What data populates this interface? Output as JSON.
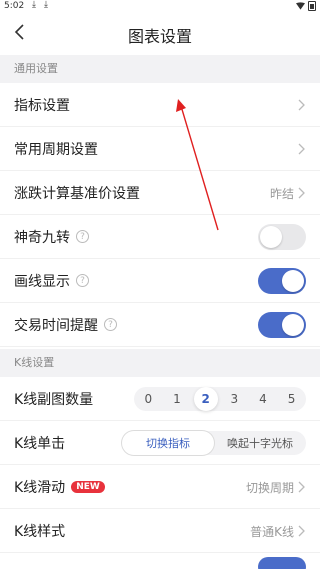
{
  "status_bar": {
    "time": "5:02"
  },
  "nav": {
    "title": "图表设置"
  },
  "sections": {
    "general": "通用设置",
    "kline": "K线设置"
  },
  "rows": {
    "indicator": {
      "label": "指标设置"
    },
    "period": {
      "label": "常用周期设置"
    },
    "base_price": {
      "label": "涨跌计算基准价设置",
      "value": "昨结"
    },
    "magic_nine": {
      "label": "神奇九转",
      "toggle": false
    },
    "drawing": {
      "label": "画线显示",
      "toggle": true
    },
    "trade_reminder": {
      "label": "交易时间提醒",
      "toggle": true
    },
    "sub_chart_count": {
      "label": "K线副图数量",
      "options": [
        "0",
        "1",
        "2",
        "3",
        "4",
        "5"
      ],
      "selected": "2"
    },
    "single_click": {
      "label": "K线单击",
      "options": [
        "切换指标",
        "唤起十字光标"
      ],
      "selected": "切换指标"
    },
    "slide": {
      "label": "K线滑动",
      "badge": "NEW",
      "value": "切换周期"
    },
    "style": {
      "label": "K线样式",
      "value": "普通K线"
    }
  },
  "colors": {
    "accent": "#4a6cc9",
    "badge": "#e8323c",
    "annotation_arrow": "#e02020"
  }
}
